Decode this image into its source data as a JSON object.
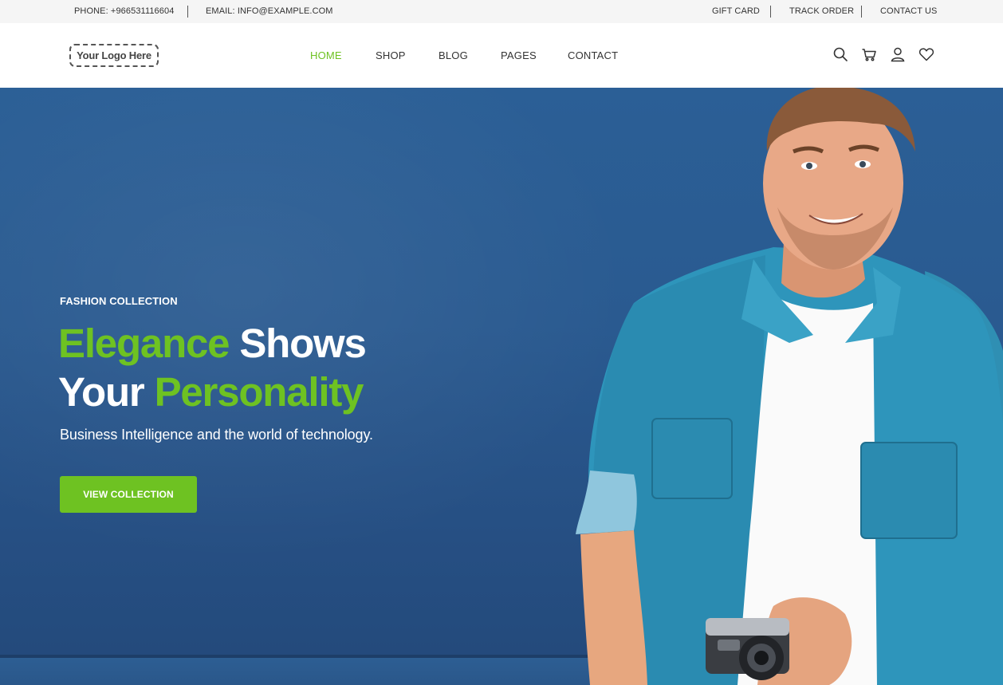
{
  "topbar": {
    "phone": "PHONE: +966531116604",
    "email": "EMAIL: INFO@EXAMPLE.COM",
    "links": [
      "GIFT CARD",
      "TRACK ORDER",
      "CONTACT US"
    ]
  },
  "header": {
    "logo_text": "Your Logo Here",
    "nav": [
      "HOME",
      "SHOP",
      "BLOG",
      "PAGES",
      "CONTACT"
    ],
    "active_nav": "HOME",
    "icons": [
      "search-icon",
      "cart-icon",
      "user-icon",
      "heart-icon"
    ]
  },
  "hero": {
    "kicker": "FASHION COLLECTION",
    "headline": {
      "line1_green": "Elegance",
      "line1_white": " Shows",
      "line2_white": "Your ",
      "line2_green": "Personality"
    },
    "subtitle": "Business Intelligence and the world of technology.",
    "cta_label": "VIEW COLLECTION"
  },
  "colors": {
    "accent": "#6ec222",
    "hero_bg": "#2a5a90",
    "topbar_bg": "#f5f5f5",
    "text": "#333333"
  }
}
